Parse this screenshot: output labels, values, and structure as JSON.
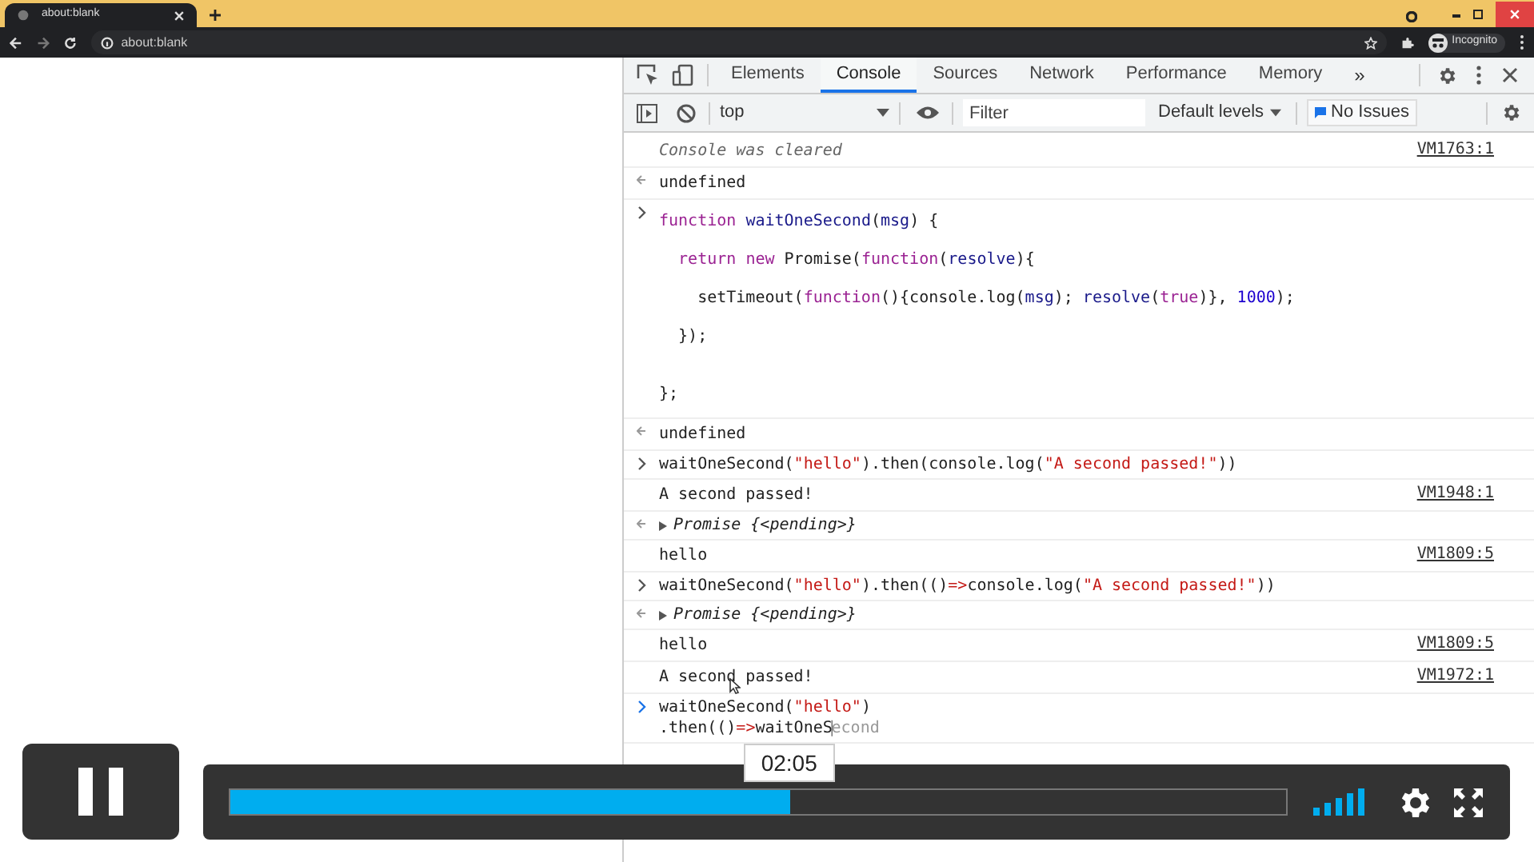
{
  "browser": {
    "tab": {
      "title": "about:blank"
    },
    "address": "about:blank",
    "profile": "Incognito"
  },
  "devtools": {
    "tabs": [
      {
        "label": "Elements",
        "selected": false
      },
      {
        "label": "Console",
        "selected": true
      },
      {
        "label": "Sources",
        "selected": false
      },
      {
        "label": "Network",
        "selected": false
      },
      {
        "label": "Performance",
        "selected": false
      },
      {
        "label": "Memory",
        "selected": false
      }
    ],
    "more": "»",
    "console_toolbar": {
      "context": "top",
      "filter": {
        "placeholder": "Filter"
      },
      "levels": "Default levels",
      "issues": "No Issues"
    },
    "console": [
      {
        "kind": "info",
        "text": "Console was cleared",
        "source": "VM1763:1"
      },
      {
        "kind": "result",
        "text": "undefined"
      },
      {
        "kind": "input",
        "loose": true,
        "lines": [
          {
            "tokens": [
              {
                "kind": "keyword",
                "text": "function"
              },
              {
                "kind": "def",
                "text": " waitOneSecond"
              },
              {
                "kind": "plain",
                "text": "("
              },
              {
                "kind": "def",
                "text": "msg"
              },
              {
                "kind": "plain",
                "text": ") {"
              }
            ]
          },
          {
            "tokens": [
              {
                "kind": "keyword",
                "text": "  return"
              },
              {
                "kind": "keyword",
                "text": " new"
              },
              {
                "kind": "plain",
                "text": " Promise("
              },
              {
                "kind": "keyword",
                "text": "function"
              },
              {
                "kind": "plain",
                "text": "("
              },
              {
                "kind": "def",
                "text": "resolve"
              },
              {
                "kind": "plain",
                "text": "){"
              }
            ]
          },
          {
            "tokens": [
              {
                "kind": "plain",
                "text": "    setTimeout("
              },
              {
                "kind": "keyword",
                "text": "function"
              },
              {
                "kind": "plain",
                "text": "(){console.log("
              },
              {
                "kind": "def",
                "text": "msg"
              },
              {
                "kind": "plain",
                "text": "); "
              },
              {
                "kind": "def",
                "text": "resolve"
              },
              {
                "kind": "plain",
                "text": "("
              },
              {
                "kind": "keyword",
                "text": "true"
              },
              {
                "kind": "plain",
                "text": ")}, "
              },
              {
                "kind": "number",
                "text": "1000"
              },
              {
                "kind": "plain",
                "text": ");"
              }
            ]
          },
          {
            "tokens": [
              {
                "kind": "plain",
                "text": "  });"
              }
            ]
          },
          {
            "blank_before": true,
            "tokens": [
              {
                "kind": "plain",
                "text": "};"
              }
            ]
          }
        ]
      },
      {
        "kind": "result",
        "text": "undefined"
      },
      {
        "kind": "input",
        "lines": [
          {
            "tokens": [
              {
                "kind": "plain",
                "text": "waitOneSecond("
              },
              {
                "kind": "string",
                "text": "\"hello\""
              },
              {
                "kind": "plain",
                "text": ").then(console.log("
              },
              {
                "kind": "string",
                "text": "\"A second passed!\""
              },
              {
                "kind": "plain",
                "text": "))"
              }
            ]
          }
        ]
      },
      {
        "kind": "log",
        "text": "A second passed!",
        "source": "VM1948:1"
      },
      {
        "kind": "promise",
        "text": "Promise {<pending>}"
      },
      {
        "kind": "log",
        "text": "hello",
        "source": "VM1809:5"
      },
      {
        "kind": "input",
        "lines": [
          {
            "tokens": [
              {
                "kind": "plain",
                "text": "waitOneSecond("
              },
              {
                "kind": "string",
                "text": "\"hello\""
              },
              {
                "kind": "plain",
                "text": ").then(()"
              },
              {
                "kind": "operator",
                "text": "=>"
              },
              {
                "kind": "plain",
                "text": "console.log("
              },
              {
                "kind": "string",
                "text": "\"A second passed!\""
              },
              {
                "kind": "plain",
                "text": "))"
              }
            ]
          }
        ]
      },
      {
        "kind": "promise",
        "text": "Promise {<pending>}"
      },
      {
        "kind": "log",
        "text": "hello",
        "source": "VM1809:5"
      },
      {
        "kind": "log",
        "text": "A second passed!",
        "source": "VM1972:1"
      },
      {
        "kind": "prompt",
        "lines": [
          {
            "tokens": [
              {
                "kind": "plain",
                "text": "waitOneSecond("
              },
              {
                "kind": "string",
                "text": "\"hello\""
              },
              {
                "kind": "plain",
                "text": ")"
              }
            ]
          },
          {
            "tokens": [
              {
                "kind": "plain",
                "text": ".then(()"
              },
              {
                "kind": "operator",
                "text": "=>"
              },
              {
                "kind": "plain",
                "text": "waitOneS"
              },
              {
                "kind": "caret",
                "text": "|"
              },
              {
                "kind": "hint",
                "text": "econd"
              }
            ]
          }
        ]
      }
    ]
  },
  "video": {
    "time": "02:05",
    "level": 0.53
  }
}
